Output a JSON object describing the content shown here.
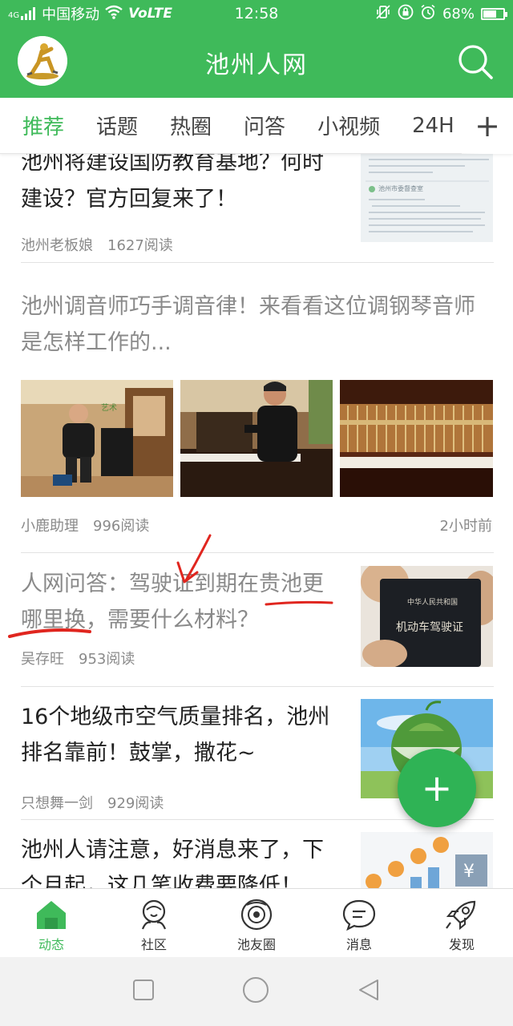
{
  "status_bar": {
    "signal": "4G",
    "carrier": "中国移动",
    "volte": "VoLTE",
    "time": "12:58",
    "battery_percent": "68%",
    "battery_level": 0.68
  },
  "header": {
    "title": "池州人网",
    "brand_color": "#3fba5a"
  },
  "tabs": [
    {
      "label": "推荐",
      "active": true
    },
    {
      "label": "话题"
    },
    {
      "label": "热圈"
    },
    {
      "label": "问答"
    },
    {
      "label": "小视频"
    },
    {
      "label": "24H"
    }
  ],
  "tabs_more": "+",
  "feed": [
    {
      "title": "池州将建设国防教育基地？何时建设？官方回复来了！",
      "author": "池州老板娘",
      "reads": "1627阅读",
      "thumb_text": "池州市委督查室"
    },
    {
      "title": "池州调音师巧手调音律！来看看这位调钢琴音师是怎样工作的...",
      "author": "小鹿助理",
      "reads": "996阅读",
      "time": "2小时前"
    },
    {
      "title": "人网问答：驾驶证到期在贵池更哪里换，需要什么材料？",
      "author": "吴存旺",
      "reads": "953阅读",
      "thumb_text_1": "中华人民共和国",
      "thumb_text_2": "机动车驾驶证"
    },
    {
      "title": "16个地级市空气质量排名，池州排名靠前！鼓掌，撒花~",
      "author": "只想舞一剑",
      "reads": "929阅读"
    },
    {
      "title": "池州人请注意，好消息来了，下个月起，这几笔收费要降低！"
    }
  ],
  "fab_label": "+",
  "bottom_nav": [
    {
      "label": "动态",
      "icon": "home-icon",
      "active": true
    },
    {
      "label": "社区",
      "icon": "community-icon"
    },
    {
      "label": "池友圈",
      "icon": "circle-icon"
    },
    {
      "label": "消息",
      "icon": "message-icon"
    },
    {
      "label": "发现",
      "icon": "rocket-icon"
    }
  ]
}
